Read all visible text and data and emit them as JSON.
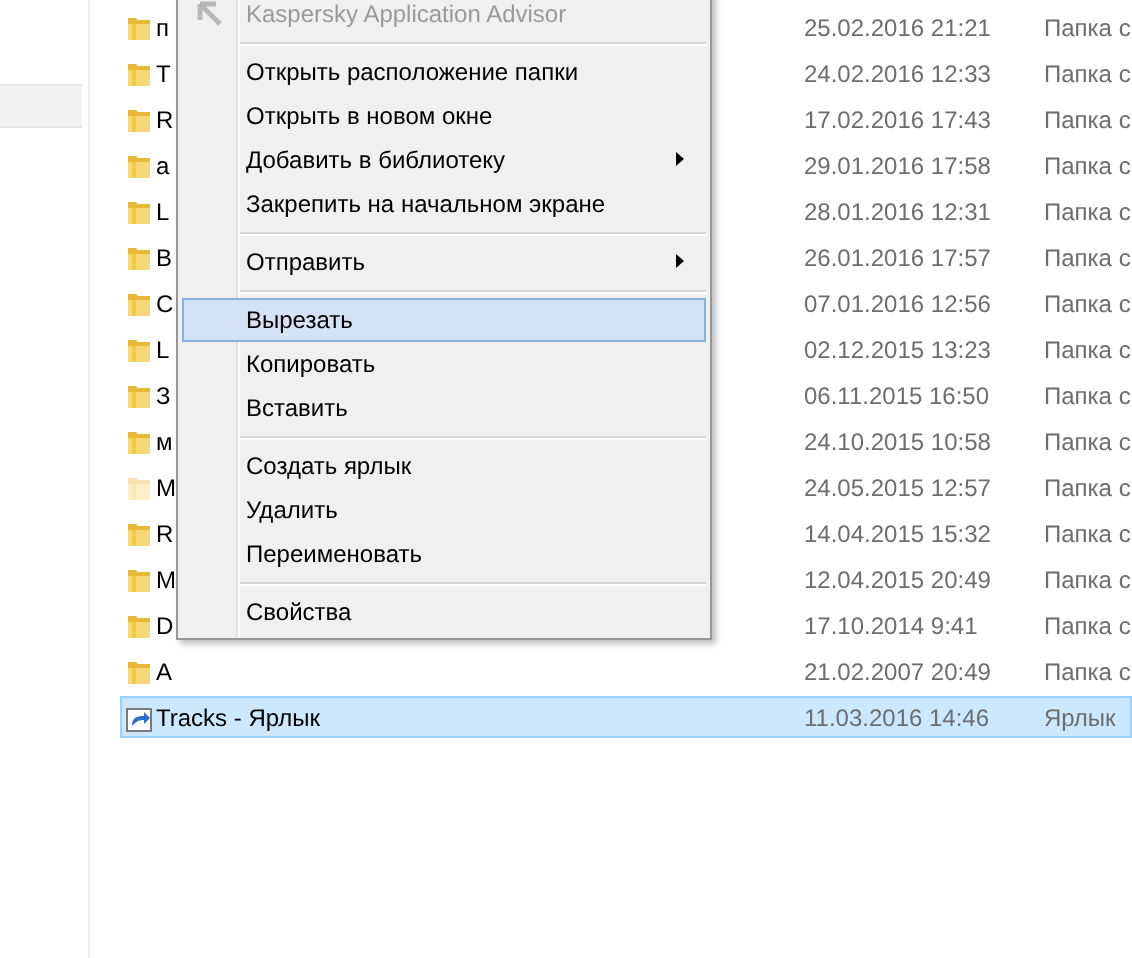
{
  "files": [
    {
      "name": "п",
      "date": "25.02.2016 21:21",
      "type": "Папка с",
      "kind": "folder",
      "hidden": false,
      "selected": false
    },
    {
      "name": "T",
      "date": "24.02.2016 12:33",
      "type": "Папка с",
      "kind": "folder",
      "hidden": false,
      "selected": false
    },
    {
      "name": "R",
      "date": "17.02.2016 17:43",
      "type": "Папка с",
      "kind": "folder",
      "hidden": false,
      "selected": false
    },
    {
      "name": "a",
      "date": "29.01.2016 17:58",
      "type": "Папка с",
      "kind": "folder",
      "hidden": false,
      "selected": false
    },
    {
      "name": "L",
      "date": "28.01.2016 12:31",
      "type": "Папка с",
      "kind": "folder",
      "hidden": false,
      "selected": false
    },
    {
      "name": "B",
      "date": "26.01.2016 17:57",
      "type": "Папка с",
      "kind": "folder",
      "hidden": false,
      "selected": false
    },
    {
      "name": "C",
      "date": "07.01.2016 12:56",
      "type": "Папка с",
      "kind": "folder",
      "hidden": false,
      "selected": false
    },
    {
      "name": "L",
      "date": "02.12.2015 13:23",
      "type": "Папка с",
      "kind": "folder",
      "hidden": false,
      "selected": false
    },
    {
      "name": "З",
      "date": "06.11.2015 16:50",
      "type": "Папка с",
      "kind": "folder",
      "hidden": false,
      "selected": false
    },
    {
      "name": "м",
      "date": "24.10.2015 10:58",
      "type": "Папка с",
      "kind": "folder",
      "hidden": false,
      "selected": false
    },
    {
      "name": "M",
      "date": "24.05.2015 12:57",
      "type": "Папка с",
      "kind": "folder",
      "hidden": true,
      "selected": false
    },
    {
      "name": "R",
      "date": "14.04.2015 15:32",
      "type": "Папка с",
      "kind": "folder",
      "hidden": false,
      "selected": false
    },
    {
      "name": "M",
      "date": "12.04.2015 20:49",
      "type": "Папка с",
      "kind": "folder",
      "hidden": false,
      "selected": false
    },
    {
      "name": "D",
      "date": "17.10.2014 9:41",
      "type": "Папка с",
      "kind": "folder",
      "hidden": false,
      "selected": false
    },
    {
      "name": "A",
      "date": "21.02.2007 20:49",
      "type": "Папка с",
      "kind": "folder",
      "hidden": false,
      "selected": false
    },
    {
      "name": "Tracks - Ярлык",
      "date": "11.03.2016 14:46",
      "type": "Ярлык",
      "kind": "shortcut",
      "hidden": false,
      "selected": true
    }
  ],
  "context_menu": {
    "items": [
      {
        "kind": "item",
        "label": "Kaspersky Application Advisor",
        "disabled": true,
        "selected": false,
        "submenu": false
      },
      {
        "kind": "separator"
      },
      {
        "kind": "item",
        "label": "Открыть расположение папки",
        "disabled": false,
        "selected": false,
        "submenu": false
      },
      {
        "kind": "item",
        "label": "Открыть в новом окне",
        "disabled": false,
        "selected": false,
        "submenu": false
      },
      {
        "kind": "item",
        "label": "Добавить в библиотеку",
        "disabled": false,
        "selected": false,
        "submenu": true
      },
      {
        "kind": "item",
        "label": "Закрепить на начальном экране",
        "disabled": false,
        "selected": false,
        "submenu": false
      },
      {
        "kind": "separator"
      },
      {
        "kind": "item",
        "label": "Отправить",
        "disabled": false,
        "selected": false,
        "submenu": true
      },
      {
        "kind": "separator"
      },
      {
        "kind": "item",
        "label": "Вырезать",
        "disabled": false,
        "selected": true,
        "submenu": false
      },
      {
        "kind": "item",
        "label": "Копировать",
        "disabled": false,
        "selected": false,
        "submenu": false
      },
      {
        "kind": "item",
        "label": "Вставить",
        "disabled": false,
        "selected": false,
        "submenu": false
      },
      {
        "kind": "separator"
      },
      {
        "kind": "item",
        "label": "Создать ярлык",
        "disabled": false,
        "selected": false,
        "submenu": false
      },
      {
        "kind": "item",
        "label": "Удалить",
        "disabled": false,
        "selected": false,
        "submenu": false
      },
      {
        "kind": "item",
        "label": "Переименовать",
        "disabled": false,
        "selected": false,
        "submenu": false
      },
      {
        "kind": "separator"
      },
      {
        "kind": "item",
        "label": "Свойства",
        "disabled": false,
        "selected": false,
        "submenu": false
      }
    ]
  }
}
